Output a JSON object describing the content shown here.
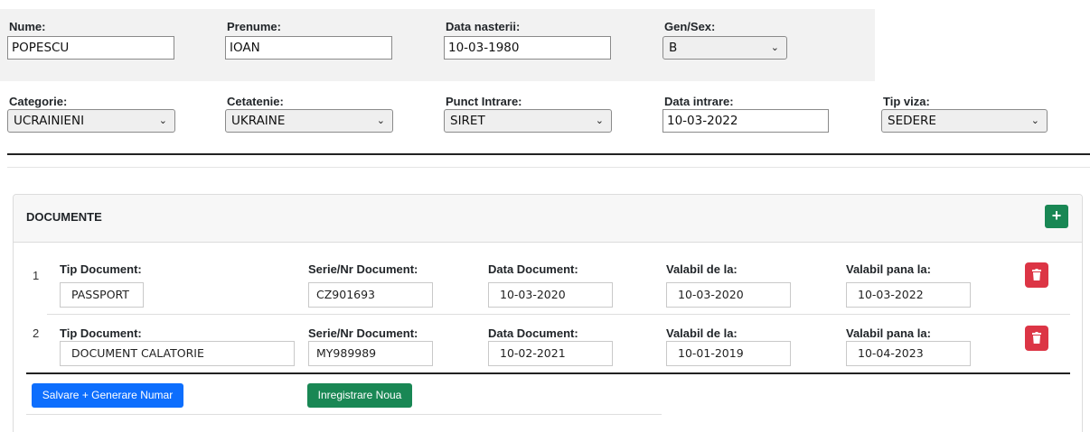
{
  "personal": {
    "nume_label": "Nume:",
    "nume_value": "POPESCU",
    "prenume_label": "Prenume:",
    "prenume_value": "IOAN",
    "data_nasterii_label": "Data nasterii:",
    "data_nasterii_value": "10-03-1980",
    "gen_label": "Gen/Sex:",
    "gen_value": "B"
  },
  "entry": {
    "categorie_label": "Categorie:",
    "categorie_value": "UCRAINIENI",
    "cetatenie_label": "Cetatenie:",
    "cetatenie_value": "UKRAINE",
    "punct_label": "Punct Intrare:",
    "punct_value": "SIRET",
    "data_intrare_label": "Data intrare:",
    "data_intrare_value": "10-03-2022",
    "tip_viza_label": "Tip viza:",
    "tip_viza_value": "SEDERE"
  },
  "documents": {
    "title": "DOCUMENTE",
    "add_label": "+",
    "col_labels": {
      "tip": "Tip Document:",
      "serie": "Serie/Nr Document:",
      "data": "Data Document:",
      "valabil_de": "Valabil de la:",
      "valabil_pana": "Valabil pana la:"
    },
    "rows": [
      {
        "nr": "1",
        "tip": "PASSPORT",
        "serie": "CZ901693",
        "data": "10-03-2020",
        "valabil_de": "10-03-2020",
        "valabil_pana": "10-03-2022"
      },
      {
        "nr": "2",
        "tip": "DOCUMENT CALATORIE",
        "serie": "MY989989",
        "data": "10-02-2021",
        "valabil_de": "10-01-2019",
        "valabil_pana": "10-04-2023"
      }
    ]
  },
  "actions": {
    "save_label": "Salvare + Generare Numar",
    "new_label": "Inregistrare Noua"
  },
  "colors": {
    "primary": "#0d6efd",
    "success": "#198754",
    "danger": "#dc3545"
  }
}
